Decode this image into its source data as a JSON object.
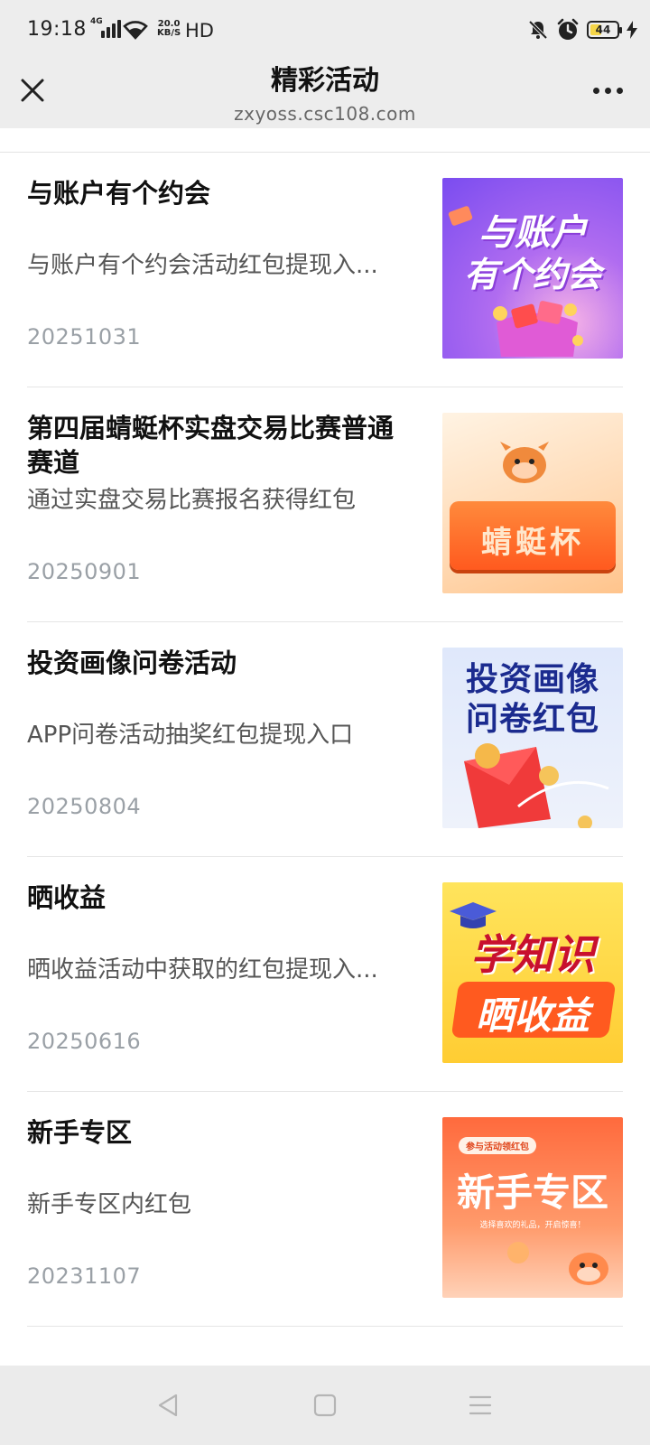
{
  "status_bar": {
    "time": "19:18",
    "network_type": "4G",
    "speed_value": "20.0",
    "speed_unit": "KB/S",
    "hd_label": "HD",
    "battery_level": "44",
    "battery_percent": 44
  },
  "header": {
    "title": "精彩活动",
    "url": "zxyoss.csc108.com"
  },
  "items": [
    {
      "title": "与账户有个约会",
      "desc": "与账户有个约会活动红包提现入...",
      "date": "20251031",
      "thumb_text_1": "与账户",
      "thumb_text_2": "有个约会"
    },
    {
      "title": "第四届蜻蜓杯实盘交易比赛普通赛道",
      "desc": "通过实盘交易比赛报名获得红包",
      "date": "20250901",
      "thumb_text_1": "蜻蜓杯"
    },
    {
      "title": "投资画像问卷活动",
      "desc": "APP问卷活动抽奖红包提现入口",
      "date": "20250804",
      "thumb_text_1": "投资画像",
      "thumb_text_2": "问卷红包"
    },
    {
      "title": "晒收益",
      "desc": "晒收益活动中获取的红包提现入...",
      "date": "20250616",
      "thumb_text_1": "学知识",
      "thumb_text_2": "晒收益"
    },
    {
      "title": "新手专区",
      "desc": "新手专区内红包",
      "date": "20231107",
      "thumb_badge": "参与活动领红包",
      "thumb_text_1": "新手专区",
      "thumb_text_2": "选择喜欢的礼品，开启惊喜！"
    }
  ],
  "colors": {
    "header_bg": "#ededed",
    "divider": "#e5e5e5",
    "date_text": "#9aa0a6"
  }
}
